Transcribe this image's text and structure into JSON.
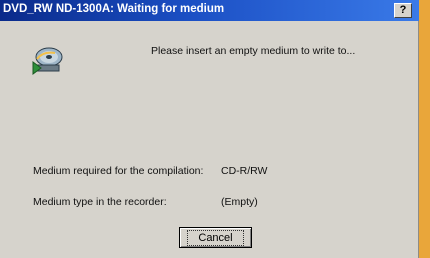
{
  "window": {
    "title": "DVD_RW ND-1300A: Waiting for medium",
    "help_label": "?"
  },
  "icons": {
    "disc": "disc-insert-icon"
  },
  "message": "Please insert an empty medium to write to...",
  "info": {
    "required_label": "Medium required for the compilation:",
    "required_value": "CD-R/RW",
    "recorder_label": "Medium type in the recorder:",
    "recorder_value": "(Empty)"
  },
  "buttons": {
    "cancel_label": "Cancel"
  },
  "colors": {
    "titlebar": "#1b4fc4",
    "dialog_bg": "#d6d3cc",
    "desktop_bg": "#e9a63a"
  }
}
